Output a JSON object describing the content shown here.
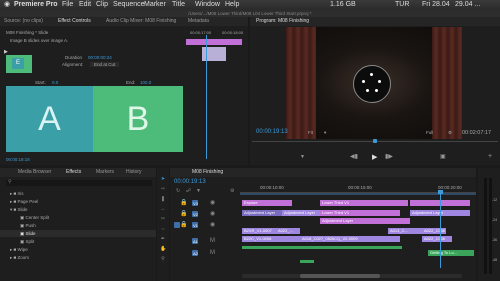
{
  "menubar": {
    "apple": "",
    "app": "Premiere Pro",
    "items": [
      "File",
      "Edit",
      "Clip",
      "Sequence",
      "Marker",
      "Title",
      "Window",
      "Help"
    ],
    "status": [
      "1.16 GB",
      "TUR",
      "Fri 28.04",
      "29.04 ..."
    ]
  },
  "path": "/Users/.../M08 Lower Third/M08 L04 Lower Third Start.prproj *",
  "effect_controls": {
    "tabs": [
      "Source: (no clips)",
      "Effect Controls",
      "Audio Clip Mixer: M08 Finishing",
      "Metadata"
    ],
    "title": "M08 Finishing * Slide",
    "desc": "Image B slides over image A.",
    "duration_label": "Duration",
    "duration_value": "00:00:00:24",
    "alignment_label": "Alignment:",
    "alignment_value": "End at Cut",
    "start_label": "Start:",
    "start_value": "0.0",
    "end_label": "End:",
    "end_value": "100.0",
    "label_a": "A",
    "label_b": "B",
    "ruler": [
      "00:00:17:00",
      "00:00:18:00"
    ],
    "timecode": "00:00:18:18",
    "colors": {
      "a": "#3a9fa6",
      "b": "#4dbb7a"
    }
  },
  "program": {
    "title": "Program: M08 Finishing",
    "timecode": "00:00:19:13",
    "fit": "Fit",
    "quality": "Full",
    "duration": "00:02:07:17"
  },
  "effects": {
    "tabs": [
      "Media Browser",
      "Effects",
      "Markers",
      "History"
    ],
    "items": [
      "Iris",
      "Page Peel",
      "Slide",
      "Center Split",
      "Push",
      "Slide",
      "Split",
      "Wipe",
      "Zoom"
    ]
  },
  "timeline": {
    "title": "M08 Finishing",
    "timecode": "00:00:19:13",
    "ruler": [
      "00:00:10:00",
      "00:00:15:00",
      "00:00:20:00"
    ],
    "tracks": [
      "V3",
      "V2",
      "V1",
      "A1",
      "A2"
    ],
    "clips": {
      "explore": "Explore",
      "adjustment": "Adjustment Layer",
      "lower_third_v1": "Lower Third V1",
      "lower_third_v1b": "Lower Third V1",
      "adjustment_v2": "Adjustment Layer",
      "adjustment_v3": "Adjustment Layer",
      "v1_a": "B2XR_V1-0007",
      "v1_b": "A022_...",
      "v1_c": "B22C_V1-0008",
      "v1_d": "A018_C027_0826CQ_V2-0009",
      "v1_e": "A013_C...",
      "v1_f": "A022_C006",
      "v1_g": "A022_C006",
      "a1_label": "Getting To Lo..."
    },
    "meter": [
      "-12",
      "-24",
      "-36",
      "-48"
    ]
  }
}
